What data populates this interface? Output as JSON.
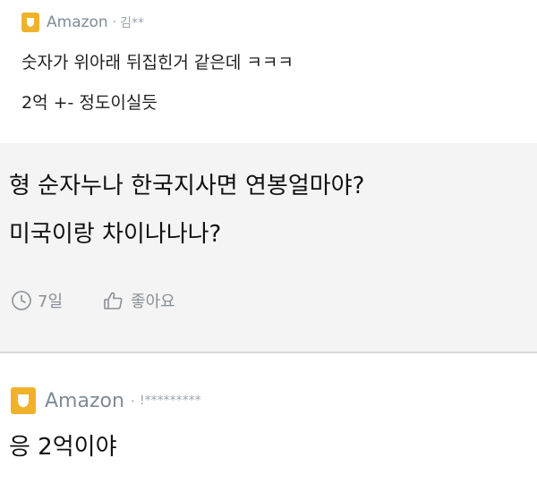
{
  "reply": {
    "company": "Amazon",
    "separator": "·",
    "author": "김**",
    "lines": [
      "숫자가 위아래 뒤집힌거 같은데 ㅋㅋㅋ",
      "2억 +- 정도이실듯"
    ]
  },
  "post": {
    "lines": [
      "형 순자누나 한국지사면 연봉얼마야?",
      "미국이랑 차이나나나?"
    ],
    "time": "7일",
    "like_label": "좋아요"
  },
  "comment": {
    "company": "Amazon",
    "separator": "·",
    "author": "!*********",
    "text": "응 2억이야"
  },
  "colors": {
    "badge": "#f0b22a",
    "company_text": "#7f8b98",
    "muted_text": "#8a8f96",
    "background": "#f4f4f4"
  },
  "icons": [
    "company-badge-icon",
    "clock-icon",
    "thumbs-up-icon"
  ]
}
